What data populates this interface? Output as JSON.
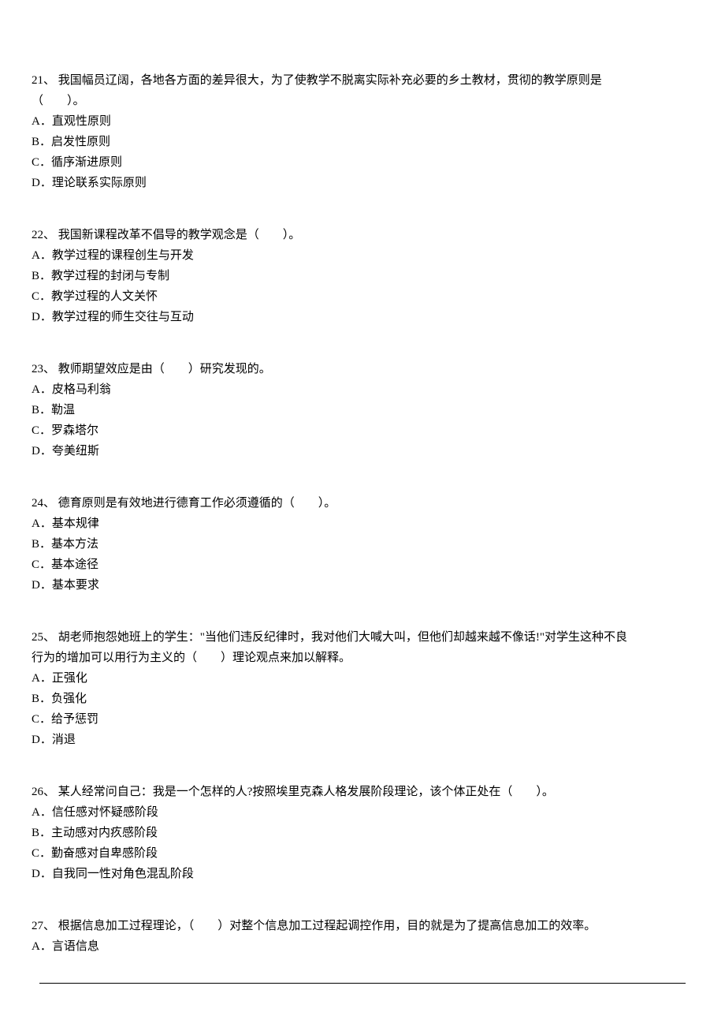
{
  "questions": [
    {
      "num": "21、",
      "stem_line1": "我国幅员辽阔，各地各方面的差异很大，为了使教学不脱离实际补充必要的乡土教材，贯彻的教学原则是",
      "stem_line2": "（　　）。",
      "options": [
        "A．直观性原则",
        "B．启发性原则",
        "C．循序渐进原则",
        "D．理论联系实际原则"
      ]
    },
    {
      "num": "22、",
      "stem_line1": "我国新课程改革不倡导的教学观念是（　　）。",
      "stem_line2": "",
      "options": [
        "A．教学过程的课程创生与开发",
        "B．教学过程的封闭与专制",
        "C．教学过程的人文关怀",
        "D．教学过程的师生交往与互动"
      ]
    },
    {
      "num": "23、",
      "stem_line1": "教师期望效应是由（　　）研究发现的。",
      "stem_line2": "",
      "options": [
        "A．皮格马利翁",
        "B．勒温",
        "C．罗森塔尔",
        "D．夸美纽斯"
      ]
    },
    {
      "num": "24、",
      "stem_line1": "德育原则是有效地进行德育工作必须遵循的（　　）。",
      "stem_line2": "",
      "options": [
        "A．基本规律",
        "B．基本方法",
        "C．基本途径",
        "D．基本要求"
      ]
    },
    {
      "num": "25、",
      "stem_line1": "胡老师抱怨她班上的学生：\"当他们违反纪律时，我对他们大喊大叫，但他们却越来越不像话!\"对学生这种不良",
      "stem_line2": "行为的增加可以用行为主义的（　　）理论观点来加以解释。",
      "options": [
        "A．正强化",
        "B．负强化",
        "C．给予惩罚",
        "D．消退"
      ]
    },
    {
      "num": "26、",
      "stem_line1": "某人经常问自己：我是一个怎样的人?按照埃里克森人格发展阶段理论，该个体正处在（　　）。",
      "stem_line2": "",
      "options": [
        "A．信任感对怀疑感阶段",
        "B．主动感对内疚感阶段",
        "C．勤奋感对自卑感阶段",
        "D．自我同一性对角色混乱阶段"
      ]
    },
    {
      "num": "27、",
      "stem_line1": "根据信息加工过程理论，（　　）对整个信息加工过程起调控作用，目的就是为了提高信息加工的效率。",
      "stem_line2": "",
      "options": [
        "A．言语信息"
      ]
    }
  ]
}
